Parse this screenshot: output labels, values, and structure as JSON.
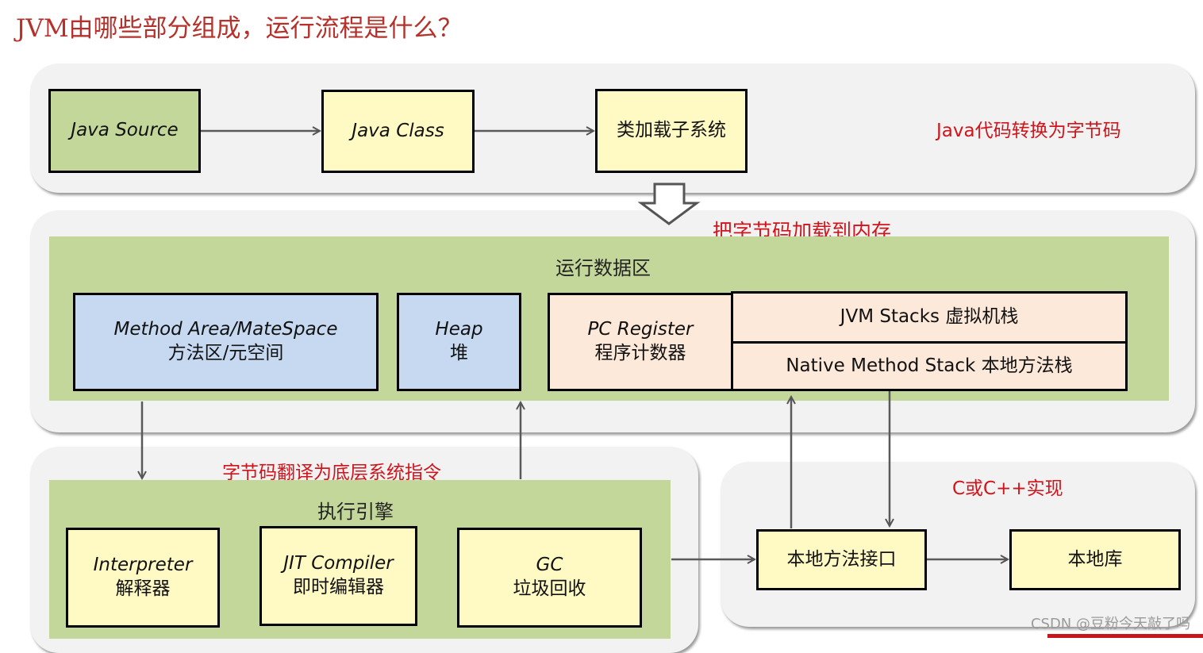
{
  "title": "JVM由哪些部分组成，运行流程是什么？",
  "stage1": {
    "java_source": "Java Source",
    "java_class": "Java Class",
    "class_loader": "类加载子系统",
    "note": "Java代码转换为字节码"
  },
  "stage2": {
    "note": "把字节码加载到内存",
    "area_label": "运行数据区",
    "method_area_en": "Method Area/MateSpace",
    "method_area_zh": "方法区/元空间",
    "heap_en": "Heap",
    "heap_zh": "堆",
    "pc_en": "PC Register",
    "pc_zh": "程序计数器",
    "jvm_stacks": "JVM Stacks 虚拟机栈",
    "native_stack": "Native Method Stack 本地方法栈"
  },
  "stage3": {
    "note": "字节码翻译为底层系统指令",
    "engine_label": "执行引擎",
    "interpreter_en": "Interpreter",
    "interpreter_zh": "解释器",
    "jit_en": "JIT Compiler",
    "jit_zh": "即时编辑器",
    "gc_en": "GC",
    "gc_zh": "垃圾回收"
  },
  "stage4": {
    "note": "C或C++实现",
    "native_interface": "本地方法接口",
    "native_library": "本地库"
  },
  "watermark": "CSDN @豆粉今天敲了吗",
  "colors": {
    "title": "#b5312b",
    "note": "#d0141b",
    "green": "#c4d79b",
    "yellow": "#fff9c4",
    "blue": "#c6d9f1",
    "peach": "#fde9d9"
  }
}
